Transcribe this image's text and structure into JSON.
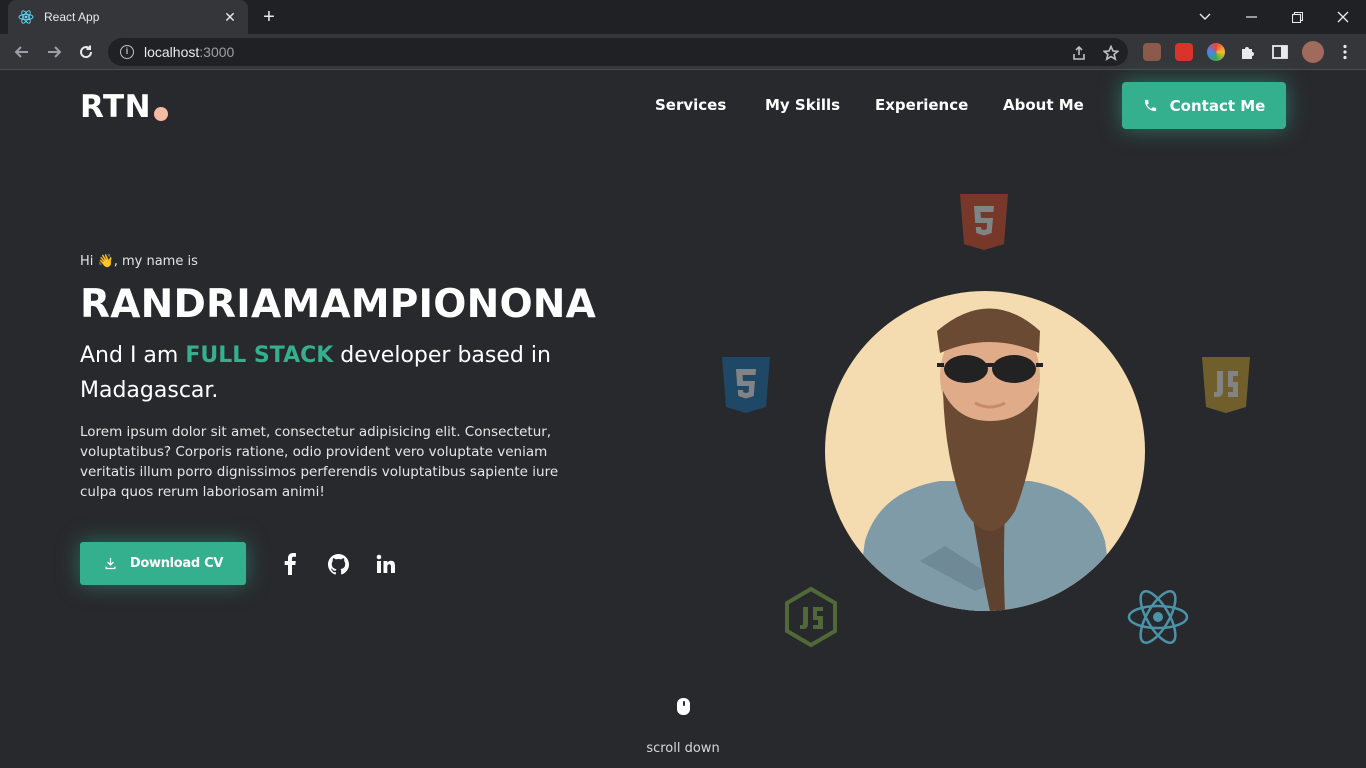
{
  "browser": {
    "tab_title": "React App",
    "tab_close": "✕",
    "new_tab": "+",
    "url_host": "localhost",
    "url_port": ":3000"
  },
  "site": {
    "logo": "RTN",
    "nav": [
      "Services",
      "My Skills",
      "Experience",
      "About Me"
    ],
    "contact_label": "Contact Me",
    "accent_color": "#34b08e",
    "background_color": "#28292d"
  },
  "hero": {
    "greeting": "Hi 👋, my name is",
    "name": "RANDRIAMAMPIONONA",
    "tagline_prefix": "And I am ",
    "tagline_highlight": "FULL STACK",
    "tagline_suffix": " developer based in Madagascar.",
    "description": "Lorem ipsum dolor sit amet, consectetur adipisicing elit. Consectetur, voluptatibus? Corporis ratione, odio provident vero voluptate veniam veritatis illum porro dignissimos perferendis voluptatibus sapiente iure culpa quos rerum laboriosam animi!",
    "download_label": "Download CV",
    "socials": [
      "facebook-icon",
      "github-icon",
      "linkedin-icon"
    ],
    "tech_icons": [
      "html5-icon",
      "css3-icon",
      "js-icon",
      "nodejs-icon",
      "react-icon"
    ],
    "scroll_label": "scroll down"
  }
}
